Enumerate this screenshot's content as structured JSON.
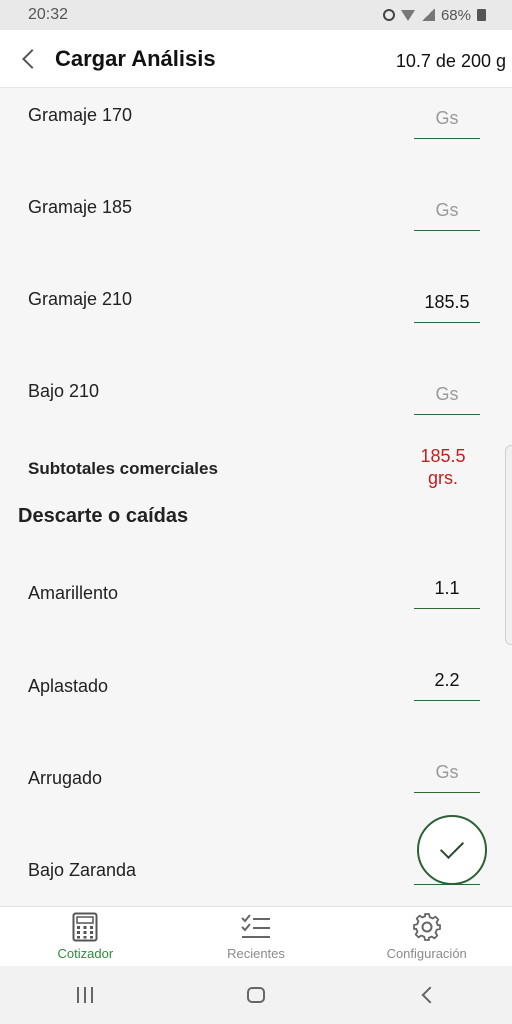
{
  "status_bar": {
    "time": "20:32",
    "battery": "68%",
    "icons": [
      "alarm-icon",
      "wifi-icon",
      "signal-icon",
      "battery-icon"
    ]
  },
  "app_bar": {
    "title": "Cargar Análisis",
    "progress": "10.7 de 200 g",
    "back_icon": "chevron-left-icon"
  },
  "rows_top": [
    {
      "label": "Gramaje 170",
      "value": "",
      "placeholder": "Gs"
    },
    {
      "label": "Gramaje 185",
      "value": "",
      "placeholder": "Gs"
    },
    {
      "label": "Gramaje 210",
      "value": "185.5",
      "placeholder": "Gs"
    },
    {
      "label": "Bajo 210",
      "value": "",
      "placeholder": "Gs"
    }
  ],
  "subtotal": {
    "label": "Subtotales comerciales",
    "value": "185.5",
    "unit": "grs."
  },
  "section": {
    "title": "Descarte o caídas"
  },
  "rows_bottom": [
    {
      "label": "Amarillento",
      "value": "1.1",
      "placeholder": "Gs"
    },
    {
      "label": "Aplastado",
      "value": "2.2",
      "placeholder": "Gs"
    },
    {
      "label": "Arrugado",
      "value": "",
      "placeholder": "Gs"
    },
    {
      "label": "Bajo Zaranda",
      "value": "",
      "placeholder": "Gs"
    }
  ],
  "fab": {
    "icon": "check-icon"
  },
  "bottom_nav": {
    "items": [
      {
        "label": "Cotizador",
        "icon": "calculator-icon",
        "active": true
      },
      {
        "label": "Recientes",
        "icon": "checklist-icon",
        "active": false
      },
      {
        "label": "Configuración",
        "icon": "gear-icon",
        "active": false
      }
    ]
  },
  "colors": {
    "accent_green": "#2e8a3c",
    "input_underline": "#2a6a34",
    "subtotal_red": "#c41e1e"
  }
}
